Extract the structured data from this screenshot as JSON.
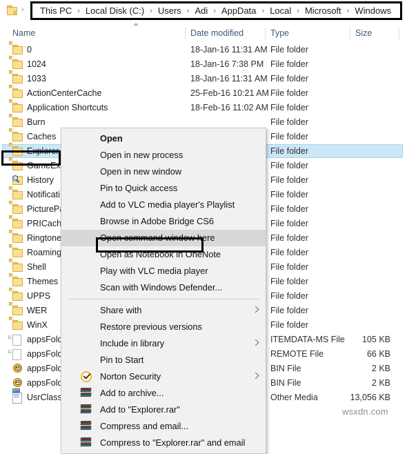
{
  "window": {
    "app": "file-explorer"
  },
  "addressbar": {
    "folder_icon": "folder-icon",
    "leading_separator": "›",
    "separator": "›",
    "crumbs": [
      "This PC",
      "Local Disk (C:)",
      "Users",
      "Adi",
      "AppData",
      "Local",
      "Microsoft",
      "Windows"
    ]
  },
  "columns": {
    "name": "Name",
    "date_modified": "Date modified",
    "type": "Type",
    "size": "Size",
    "sort_indicator": "sort-ascending-caret"
  },
  "files": [
    {
      "name": "0",
      "date": "18-Jan-16 11:31 AM",
      "type": "File folder",
      "size": "",
      "icon": "folder-icon",
      "selected": false
    },
    {
      "name": "1024",
      "date": "18-Jan-16 7:38 PM",
      "type": "File folder",
      "size": "",
      "icon": "folder-icon",
      "selected": false
    },
    {
      "name": "1033",
      "date": "18-Jan-16 11:31 AM",
      "type": "File folder",
      "size": "",
      "icon": "folder-icon",
      "selected": false
    },
    {
      "name": "ActionCenterCache",
      "date": "25-Feb-16 10:21 AM",
      "type": "File folder",
      "size": "",
      "icon": "folder-icon",
      "selected": false
    },
    {
      "name": "Application Shortcuts",
      "date": "18-Feb-16 11:02 AM",
      "type": "File folder",
      "size": "",
      "icon": "folder-icon",
      "selected": false
    },
    {
      "name": "Burn",
      "date": "",
      "type": "File folder",
      "size": "",
      "icon": "folder-icon",
      "selected": false
    },
    {
      "name": "Caches",
      "date": "",
      "type": "File folder",
      "size": "",
      "icon": "folder-icon",
      "selected": false
    },
    {
      "name": "Explorer",
      "date": "",
      "type": "File folder",
      "size": "",
      "icon": "folder-icon",
      "selected": true
    },
    {
      "name": "GameExp",
      "date": "",
      "type": "File folder",
      "size": "",
      "icon": "folder-icon",
      "selected": false
    },
    {
      "name": "History",
      "date": "",
      "type": "File folder",
      "size": "",
      "icon": "history-icon",
      "selected": false
    },
    {
      "name": "Notificati",
      "date": "",
      "type": "File folder",
      "size": "",
      "icon": "folder-icon",
      "selected": false
    },
    {
      "name": "PicturePa",
      "date": "",
      "type": "File folder",
      "size": "",
      "icon": "folder-icon",
      "selected": false
    },
    {
      "name": "PRICache",
      "date": "",
      "type": "File folder",
      "size": "",
      "icon": "folder-icon",
      "selected": false
    },
    {
      "name": "Ringtone",
      "date": "",
      "type": "File folder",
      "size": "",
      "icon": "folder-icon",
      "selected": false
    },
    {
      "name": "Roaming",
      "date": "",
      "type": "File folder",
      "size": "",
      "icon": "folder-icon",
      "selected": false
    },
    {
      "name": "Shell",
      "date": "",
      "type": "File folder",
      "size": "",
      "icon": "folder-icon",
      "selected": false
    },
    {
      "name": "Themes",
      "date": "",
      "type": "File folder",
      "size": "",
      "icon": "folder-icon",
      "selected": false
    },
    {
      "name": "UPPS",
      "date": "",
      "type": "File folder",
      "size": "",
      "icon": "folder-icon",
      "selected": false
    },
    {
      "name": "WER",
      "date": "",
      "type": "File folder",
      "size": "",
      "icon": "folder-icon",
      "selected": false
    },
    {
      "name": "WinX",
      "date": "",
      "type": "File folder",
      "size": "",
      "icon": "folder-icon",
      "selected": false
    },
    {
      "name": "appsFold",
      "date": "",
      "type": "ITEMDATA-MS File",
      "size": "105 KB",
      "icon": "file-icon",
      "selected": false
    },
    {
      "name": "appsFold",
      "date": "",
      "type": "REMOTE File",
      "size": "66 KB",
      "icon": "file-icon",
      "selected": false
    },
    {
      "name": "appsFold",
      "date": "",
      "type": "BIN File",
      "size": "2 KB",
      "icon": "owl-icon",
      "selected": false
    },
    {
      "name": "appsFold",
      "date": "",
      "type": "BIN File",
      "size": "2 KB",
      "icon": "owl-icon",
      "selected": false
    },
    {
      "name": "UsrClass",
      "date": "",
      "type": "Other Media",
      "size": "13,056 KB",
      "icon": "dat-icon",
      "selected": false
    }
  ],
  "context_menu": {
    "items": [
      {
        "label": "Open",
        "bold": true,
        "highlighted": false,
        "submenu": false,
        "icon": ""
      },
      {
        "label": "Open in new process",
        "bold": false,
        "highlighted": false,
        "submenu": false,
        "icon": ""
      },
      {
        "label": "Open in new window",
        "bold": false,
        "highlighted": false,
        "submenu": false,
        "icon": ""
      },
      {
        "label": "Pin to Quick access",
        "bold": false,
        "highlighted": false,
        "submenu": false,
        "icon": ""
      },
      {
        "label": "Add to VLC media player's Playlist",
        "bold": false,
        "highlighted": false,
        "submenu": false,
        "icon": ""
      },
      {
        "label": "Browse in Adobe Bridge CS6",
        "bold": false,
        "highlighted": false,
        "submenu": false,
        "icon": ""
      },
      {
        "label": "Open command window here",
        "bold": false,
        "highlighted": true,
        "submenu": false,
        "icon": ""
      },
      {
        "label": "Open as Notebook in OneNote",
        "bold": false,
        "highlighted": false,
        "submenu": false,
        "icon": ""
      },
      {
        "label": "Play with VLC media player",
        "bold": false,
        "highlighted": false,
        "submenu": false,
        "icon": ""
      },
      {
        "label": "Scan with Windows Defender...",
        "bold": false,
        "highlighted": false,
        "submenu": false,
        "icon": ""
      },
      {
        "separator": true
      },
      {
        "label": "Share with",
        "bold": false,
        "highlighted": false,
        "submenu": true,
        "icon": ""
      },
      {
        "label": "Restore previous versions",
        "bold": false,
        "highlighted": false,
        "submenu": false,
        "icon": ""
      },
      {
        "label": "Include in library",
        "bold": false,
        "highlighted": false,
        "submenu": true,
        "icon": ""
      },
      {
        "label": "Pin to Start",
        "bold": false,
        "highlighted": false,
        "submenu": false,
        "icon": ""
      },
      {
        "label": "Norton Security",
        "bold": false,
        "highlighted": false,
        "submenu": true,
        "icon": "norton-icon"
      },
      {
        "label": "Add to archive...",
        "bold": false,
        "highlighted": false,
        "submenu": false,
        "icon": "winrar-icon"
      },
      {
        "label": "Add to \"Explorer.rar\"",
        "bold": false,
        "highlighted": false,
        "submenu": false,
        "icon": "winrar-icon"
      },
      {
        "label": "Compress and email...",
        "bold": false,
        "highlighted": false,
        "submenu": false,
        "icon": "winrar-icon"
      },
      {
        "label": "Compress to \"Explorer.rar\" and email",
        "bold": false,
        "highlighted": false,
        "submenu": false,
        "icon": "winrar-icon"
      }
    ]
  },
  "annotations": {
    "explorer_highlight": "Explorer",
    "command_window_highlight": "Open command window here"
  },
  "watermark": "wsxdn.com",
  "colors": {
    "selection_fill": "#cce8f8",
    "selection_border": "#a7d3ef",
    "menu_bg": "#f1f1f1",
    "menu_highlight": "#d8d8d8",
    "annotation_box": "#000000",
    "column_header_text": "#3d5a78",
    "folder_icon": "#fbdf91"
  }
}
